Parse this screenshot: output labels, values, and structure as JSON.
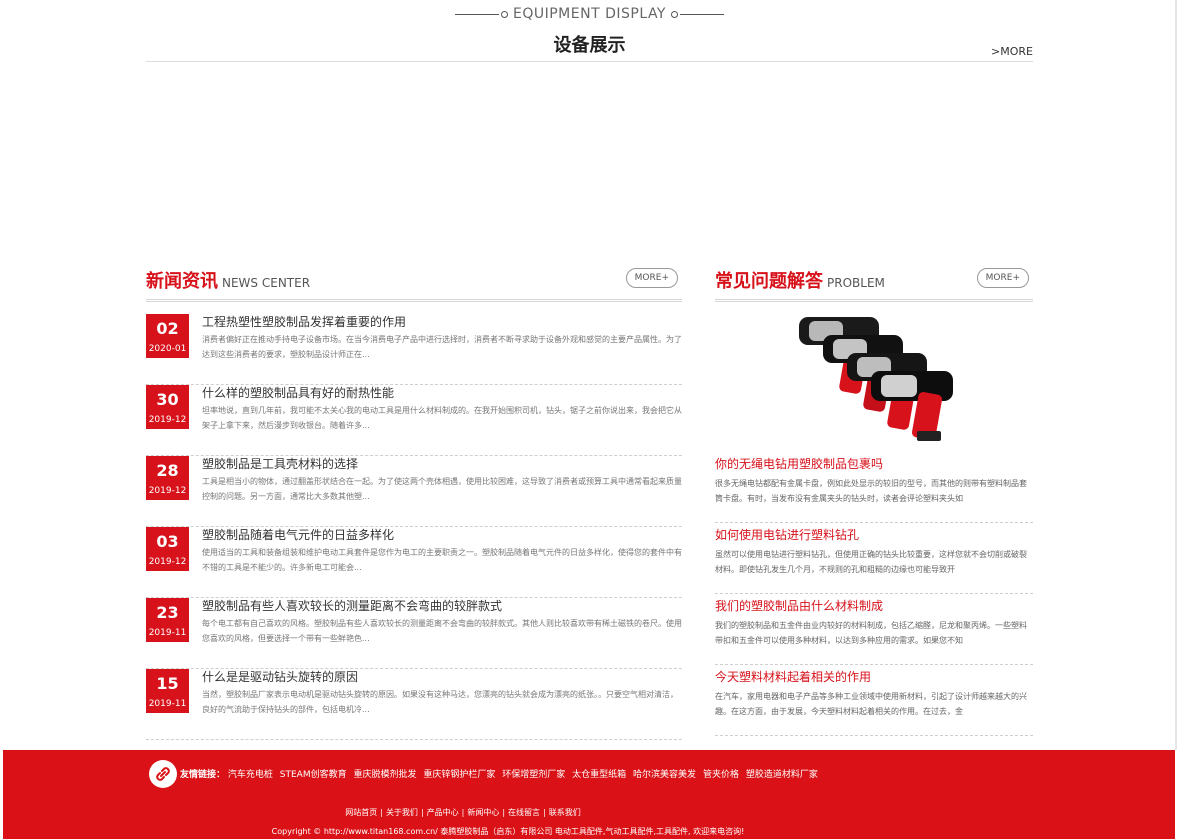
{
  "equipment": {
    "title_en": "EQUIPMENT DISPLAY",
    "title_cn": "设备展示",
    "more": ">MORE"
  },
  "news": {
    "title_cn": "新闻资讯",
    "title_en": "NEWS CENTER",
    "more": "MORE+",
    "items": [
      {
        "day": "02",
        "ym": "2020-01",
        "title": "工程热塑性塑胶制品发挥着重要的作用",
        "desc": "消费者偏好正在推动手持电子设备市场。在当今消费电子产品中进行选择时，消费者不断寻求助于设备外观和感觉的主要产品属性。为了达到这些消费者的要求，塑胶制品设计师正在..."
      },
      {
        "day": "30",
        "ym": "2019-12",
        "title": "什么样的塑胶制品具有好的耐热性能",
        "desc": "坦率地说，直到几年前，我可能不太关心我的电动工具是用什么材料制成的。在我开始围积司机，钻头，锯子之前你说出来，我会把它从架子上拿下来，然后漫步到收银台。随着许多..."
      },
      {
        "day": "28",
        "ym": "2019-12",
        "title": "塑胶制品是工具壳材料的选择",
        "desc": "工具是相当小的物体，通过翻盖形状结合在一起。为了使这两个壳体相遇，使用比较困难，这导致了消费者或预算工具中通常看起来质量控制的问题。另一方面，通常比大多数其他塑..."
      },
      {
        "day": "03",
        "ym": "2019-12",
        "title": "塑胶制品随着电气元件的日益多样化",
        "desc": "使用适当的工具和装备组装和维护电动工具套件是您作为电工的主要职责之一。塑胶制品随着电气元件的日益多样化，使得您的套件中有不错的工具是不能少的。许多新电工可能会..."
      },
      {
        "day": "23",
        "ym": "2019-11",
        "title": "塑胶制品有些人喜欢较长的测量距离不会弯曲的较胖款式",
        "desc": "每个电工都有自己喜欢的风格。塑胶制品有些人喜欢较长的测量距离不会弯曲的较胖款式。其他人则比较喜欢带有稀土磁铁的卷尺。使用您喜欢的风格，但要选择一个带有一些鲜艳色..."
      },
      {
        "day": "15",
        "ym": "2019-11",
        "title": "什么是是驱动钻头旋转的原因",
        "desc": "当然，塑胶制品厂家表示电动机是驱动钻头旋转的原因。如果没有这种马达，您漂亮的钻头就会成为漂亮的纸张。。只要空气相对清洁，良好的气流助于保持钻头的部件，包括电机冷..."
      }
    ]
  },
  "problem": {
    "title_cn": "常见问题解答",
    "title_en": "PROBLEM",
    "more": "MORE+",
    "image_alt": "impact wrench product image",
    "items": [
      {
        "title": "你的无绳电钻用塑胶制品包裹吗",
        "desc": "很多无绳电钻都配有金属卡盘，例如此处显示的较旧的型号，而其他的则带有塑料制品套筒卡盘。有时，当发布没有金属夹头的钻头时，读者会评论塑料夹头如"
      },
      {
        "title": "如何使用电钻进行塑料钻孔",
        "desc": "虽然可以使用电钻进行塑料钻孔，但使用正确的钻头比较重要，这样您就不会切削或破裂材料。即使钻孔发生几个月，不规则的孔和粗糙的边缘也可能导致开"
      },
      {
        "title": "我们的塑胶制品由什么材料制成",
        "desc": "我们的塑胶制品和五金件由业内较好的材料制成，包括乙缩醛，尼龙和聚丙烯。一些塑料带扣和五金件可以使用多种材料，以达到多种应用的需求。如果您不知"
      },
      {
        "title": "今天塑料材料起着相关的作用",
        "desc": "在汽车，家用电器和电子产品等多种工业领域中使用新材料，引起了设计师越来越大的兴趣。在这方面，由于发展，今天塑料材料起着相关的作用。在过去，金"
      }
    ]
  },
  "footer": {
    "friend_label": "友情链接：",
    "friend_links": [
      "汽车充电桩",
      "STEAM创客教育",
      "重庆脱模剂批发",
      "重庆锌钢护栏厂家",
      "环保增塑剂厂家",
      "太仓重型纸箱",
      "哈尔滨美容美发",
      "管夹价格",
      "塑胶造道材料厂家"
    ],
    "nav": [
      "网站首页",
      "关于我们",
      "产品中心",
      "新闻中心",
      "在线留言",
      "联系我们"
    ],
    "copyright": "Copyright © http://www.titan168.com.cn/ 泰腾塑胶制品（启东）有限公司 电动工具配件,气动工具配件,工具配件, 欢迎来电咨询!"
  }
}
